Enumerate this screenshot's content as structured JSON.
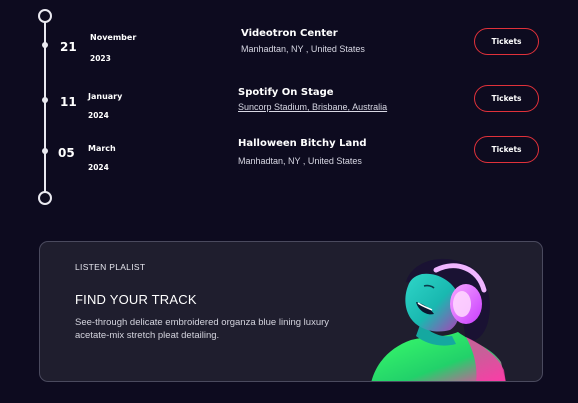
{
  "events": [
    {
      "day": "21",
      "month": "November",
      "year": "2023",
      "venue": "Videotron Center",
      "location": "Manhadtan, NY , United States",
      "location_link": false,
      "ticket_label": "Tickets"
    },
    {
      "day": "11",
      "month": "January",
      "year": "2024",
      "venue": "Spotify On Stage",
      "location": "Suncorp Stadium, Brisbane, Australia",
      "location_link": true,
      "ticket_label": "Tickets"
    },
    {
      "day": "05",
      "month": "March",
      "year": "2024",
      "venue": "Halloween Bitchy Land",
      "location": "Manhadtan, NY , United States",
      "location_link": false,
      "ticket_label": "Tickets"
    }
  ],
  "playlist": {
    "eyebrow": "LISTEN PLALIST",
    "title": "FIND YOUR TRACK",
    "description": "See-through delicate embroidered organza blue lining luxury acetate-mix stretch pleat detailing.",
    "image": "woman-with-headphones-photo"
  },
  "colors": {
    "background": "#0d0b1f",
    "ticket_border": "#e0313a",
    "card_background": "#1f1e2e",
    "timeline": "#e9e9f0"
  }
}
